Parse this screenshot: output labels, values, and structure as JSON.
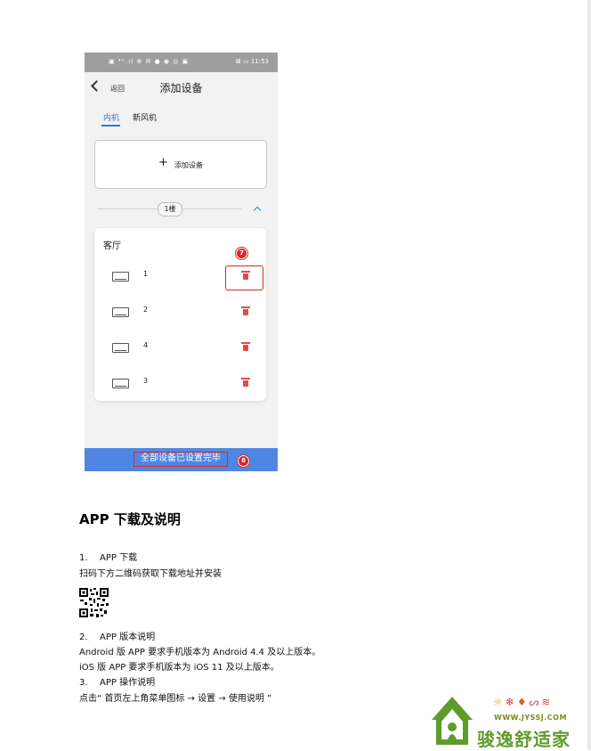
{
  "phone": {
    "status_left": "▣ ⁴ᴳ.ıl ⊕ ✉ ● ◉ ◎ ▣",
    "status_right": "⊠ ▭ 11:53",
    "nav": {
      "back_label": "返回",
      "title": "添加设备"
    },
    "tabs": [
      {
        "label": "内机",
        "active": true
      },
      {
        "label": "新风机",
        "active": false
      }
    ],
    "add_device_label": "添加设备",
    "floor_label": "1楼",
    "room": {
      "name": "客厅",
      "devices": [
        {
          "name": "1"
        },
        {
          "name": "2"
        },
        {
          "name": "4"
        },
        {
          "name": "3"
        }
      ]
    },
    "markers": {
      "delete_step": "7",
      "done_step": "8"
    },
    "done_button": "全部设备已设置完毕",
    "colors": {
      "accent": "#2f7bd6",
      "danger": "#e54848",
      "highlight": "#d62828",
      "bar": "#4f86e3"
    }
  },
  "doc": {
    "heading": "APP 下载及说明",
    "s1_num": "1.",
    "s1_title": "APP 下载",
    "s1_body": "扫码下方二维码获取下载地址并安装",
    "s2_num": "2.",
    "s2_title": "APP 版本说明",
    "s2_line1": "Android 版 APP 要求手机版本为 Android 4.4  及以上版本。",
    "s2_line2": "iOS 版 APP 要求手机版本为 iOS 11  及以上版本。",
    "s3_num": "3.",
    "s3_title": "APP 操作说明",
    "s3_body": "点击“  首页左上角菜单图标  →  设置  →  使用说明  ”"
  },
  "logo": {
    "url": "WWW.JYSSJ.COM",
    "name": "骏逸舒适家",
    "icon_names": [
      "sun-icon",
      "snowflake-icon",
      "drop-icon",
      "fan-icon",
      "wifi-icon"
    ]
  }
}
